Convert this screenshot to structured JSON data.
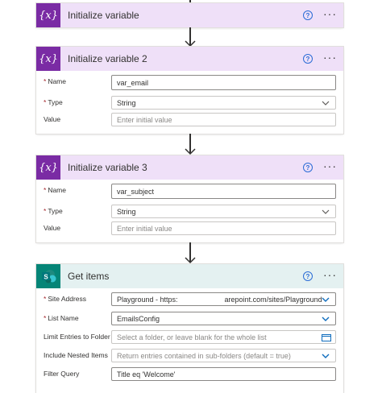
{
  "cards": [
    {
      "title": "Initialize variable",
      "icon": "variable-icon"
    },
    {
      "title": "Initialize variable 2",
      "icon": "variable-icon",
      "fields": [
        {
          "label": "Name",
          "required": true,
          "value": "var_email"
        },
        {
          "label": "Type",
          "required": true,
          "value": "String",
          "dropdown": true
        },
        {
          "label": "Value",
          "required": false,
          "placeholder": "Enter initial value"
        }
      ]
    },
    {
      "title": "Initialize variable 3",
      "icon": "variable-icon",
      "fields": [
        {
          "label": "Name",
          "required": true,
          "value": "var_subject"
        },
        {
          "label": "Type",
          "required": true,
          "value": "String",
          "dropdown": true
        },
        {
          "label": "Value",
          "required": false,
          "placeholder": "Enter initial value"
        }
      ]
    },
    {
      "title": "Get items",
      "icon": "sharepoint-icon",
      "fields": [
        {
          "label": "Site Address",
          "required": true,
          "value_part1": "Playground - https:",
          "value_part2": "arepoint.com/sites/Playground",
          "dropdown": true
        },
        {
          "label": "List Name",
          "required": true,
          "value": "EmailsConfig",
          "dropdown": true
        },
        {
          "label": "Limit Entries to Folder",
          "required": false,
          "placeholder": "Select a folder, or leave blank for the whole list"
        },
        {
          "label": "Include Nested Items",
          "required": false,
          "placeholder": "Return entries contained in sub-folders (default = true)",
          "dropdown": true
        },
        {
          "label": "Filter Query",
          "required": false,
          "value": "Title eq 'Welcome'"
        }
      ]
    }
  ],
  "icons": {
    "help": "?",
    "more": "···",
    "variable": "{x}",
    "sharepoint": "S"
  },
  "colors": {
    "variable_header": "#efe0f8",
    "variable_icon": "#7a2ba4",
    "sharepoint_header": "#e4f1f1",
    "sharepoint_icon": "#058577",
    "help": "#2b6cd6",
    "required": "#a4262c"
  }
}
